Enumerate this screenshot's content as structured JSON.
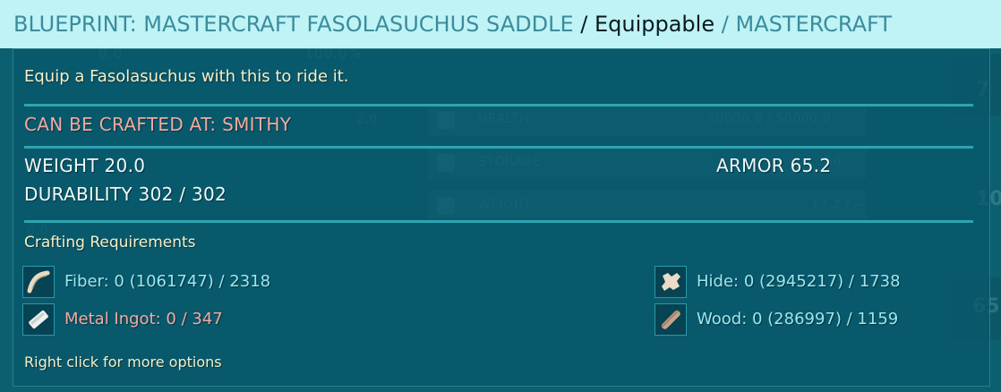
{
  "header": {
    "blueprint": "BLUEPRINT: MASTERCRAFT FASOLASUCHUS SADDLE",
    "sep1": " / ",
    "category": "Equippable",
    "sep2": " / ",
    "quality": "MASTERCRAFT"
  },
  "background": {
    "rows": [
      {
        "label": "HEALTH",
        "value": "50000.0 / 50000.0",
        "icon": "plus-icon"
      },
      {
        "label": "STORAGE",
        "value": "350",
        "icon": "box-icon"
      },
      {
        "label": "WEIGHT",
        "value": "17.2 / --",
        "icon": "weight-icon"
      }
    ],
    "left_values": [
      "0.0",
      "100.0%",
      "2.0",
      "0.0"
    ],
    "side_numbers": [
      "7",
      "10",
      "65"
    ]
  },
  "tooltip": {
    "description": "Equip a Fasolasuchus with this to ride it.",
    "crafted_at": "CAN BE CRAFTED AT: SMITHY",
    "weight": "WEIGHT 20.0",
    "durability": "DURABILITY 302 / 302",
    "armor": "ARMOR 65.2",
    "requirements_title": "Crafting Requirements",
    "requirements": [
      {
        "text": "Fiber: 0 (1061747) / 2318",
        "icon": "fiber-icon",
        "missing": false
      },
      {
        "text": "Hide: 0 (2945217) / 1738",
        "icon": "hide-icon",
        "missing": false
      },
      {
        "text": "Metal Ingot: 0 / 347",
        "icon": "metal-ingot-icon",
        "missing": true
      },
      {
        "text": "Wood: 0 (286997) / 1159",
        "icon": "wood-icon",
        "missing": false
      }
    ],
    "hint": "Right click for more options"
  },
  "colors": {
    "header_bg": "#bff3f6",
    "header_teal": "#3b8c9c",
    "panel_bg": "#09586c",
    "divider": "#2fa4b3",
    "description": "#f3f0c8",
    "crafted_at": "#f0aaa0",
    "requirement": "#9ae8ee",
    "requirement_missing": "#f2aba2"
  }
}
